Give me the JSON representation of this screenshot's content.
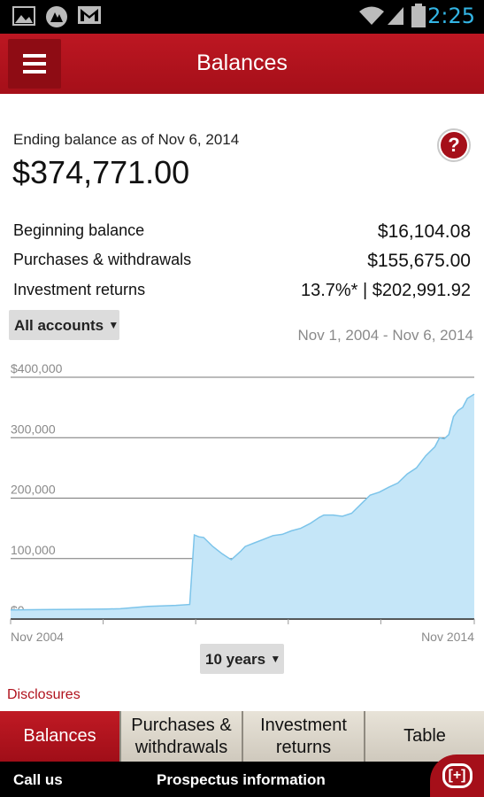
{
  "status_bar": {
    "time": "2:25",
    "icons": [
      "gallery-icon",
      "app-icon",
      "gmail-icon",
      "wifi-icon",
      "signal-icon",
      "battery-icon"
    ]
  },
  "app_bar": {
    "title": "Balances",
    "menu_icon": "hamburger-menu-icon"
  },
  "summary": {
    "ending_label": "Ending balance as of Nov 6, 2014",
    "ending_value": "$374,771.00",
    "help_icon": "question-mark-icon",
    "rows": [
      {
        "label": "Beginning balance",
        "value": "$16,104.08"
      },
      {
        "label": "Purchases & withdrawals",
        "value": "$155,675.00"
      },
      {
        "label": "Investment returns",
        "value": "13.7%* | $202,991.92"
      }
    ]
  },
  "filters": {
    "accounts_label": "All accounts",
    "date_range": "Nov 1, 2004 - Nov 6, 2014",
    "period_label": "10 years"
  },
  "chart_data": {
    "type": "area",
    "title": "",
    "xlabel": "",
    "ylabel": "",
    "ylim": [
      0,
      400000
    ],
    "y_ticks": [
      "$0",
      "100,000",
      "200,000",
      "300,000",
      "$400,000"
    ],
    "x_tick_labels": [
      "Nov 2004",
      "Nov 2014"
    ],
    "xlim": [
      2004.83,
      2014.85
    ],
    "fill_color": "#c5e6f8",
    "line_color": "#7cc4ea",
    "grid": true,
    "series": [
      {
        "x": [
          2004.83,
          2005.5,
          2006.1,
          2006.9,
          2007.2,
          2007.8,
          2008.4,
          2008.7,
          2008.8,
          2008.9,
          2009.0,
          2009.2,
          2009.4,
          2009.6,
          2009.8,
          2009.9,
          2010.1,
          2010.3,
          2010.5,
          2010.7,
          2010.9,
          2011.1,
          2011.3,
          2011.5,
          2011.6,
          2011.8,
          2012.0,
          2012.2,
          2012.4,
          2012.6,
          2012.8,
          2013.0,
          2013.2,
          2013.4,
          2013.6,
          2013.8,
          2014.0,
          2014.1,
          2014.2,
          2014.3,
          2014.4,
          2014.5,
          2014.6,
          2014.7,
          2014.85
        ],
        "values": [
          15000,
          15500,
          16000,
          16500,
          17000,
          21000,
          22500,
          24000,
          139000,
          136000,
          135000,
          120000,
          108000,
          98000,
          112000,
          120000,
          126000,
          132000,
          138000,
          140000,
          146000,
          150000,
          158000,
          168000,
          172000,
          172000,
          170000,
          175000,
          190000,
          205000,
          210000,
          218000,
          225000,
          240000,
          250000,
          270000,
          285000,
          300000,
          298000,
          305000,
          335000,
          345000,
          350000,
          365000,
          372000
        ]
      }
    ]
  },
  "disclosures": "Disclosures",
  "tabs": [
    {
      "label": "Balances",
      "active": true
    },
    {
      "label": "Purchases & withdrawals",
      "active": false
    },
    {
      "label": "Investment returns",
      "active": false
    },
    {
      "label": "Table",
      "active": false
    }
  ],
  "footer": {
    "call_us": "Call us",
    "prospectus": "Prospectus information",
    "chat_label": "[+]",
    "chat_icon": "chat-bubble-icon"
  }
}
